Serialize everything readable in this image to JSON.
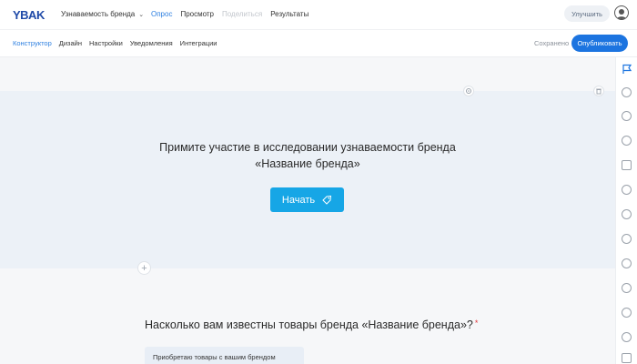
{
  "header": {
    "logo_text": "YBAK",
    "survey_title": "Узнаваемость бренда",
    "tabs": [
      {
        "label": "Опрос",
        "state": "active"
      },
      {
        "label": "Просмотр",
        "state": "normal"
      },
      {
        "label": "Поделиться",
        "state": "disabled"
      },
      {
        "label": "Результаты",
        "state": "normal"
      }
    ],
    "upgrade_label": "Улучшить"
  },
  "subheader": {
    "tabs": [
      {
        "label": "Конструктор",
        "state": "active"
      },
      {
        "label": "Дизайн",
        "state": "normal"
      },
      {
        "label": "Настройки",
        "state": "normal"
      },
      {
        "label": "Уведомления",
        "state": "normal"
      },
      {
        "label": "Интеграции",
        "state": "normal"
      }
    ],
    "saved_label": "Сохранено",
    "publish_label": "Опубликовать"
  },
  "welcome": {
    "line1": "Примите участие в исследовании узнаваемости бренда",
    "line2": "«Название бренда»",
    "start_label": "Начать"
  },
  "question": {
    "text": "Насколько вам известны товары бренда «Название бренда»?",
    "required_mark": "*",
    "first_option": "Приобретаю товары с вашим брендом"
  },
  "colors": {
    "accent": "#2d7fe0",
    "publish": "#1c74e0",
    "start": "#16a6e6",
    "welcome_bg": "#ecf1f7"
  },
  "rail_icons": [
    "flag-icon",
    "circle-icon",
    "circle-icon",
    "circle-icon",
    "checkbox-icon",
    "circle-icon",
    "circle-icon",
    "circle-icon",
    "circle-icon",
    "circle-icon",
    "circle-icon",
    "circle-icon",
    "circle-icon"
  ]
}
